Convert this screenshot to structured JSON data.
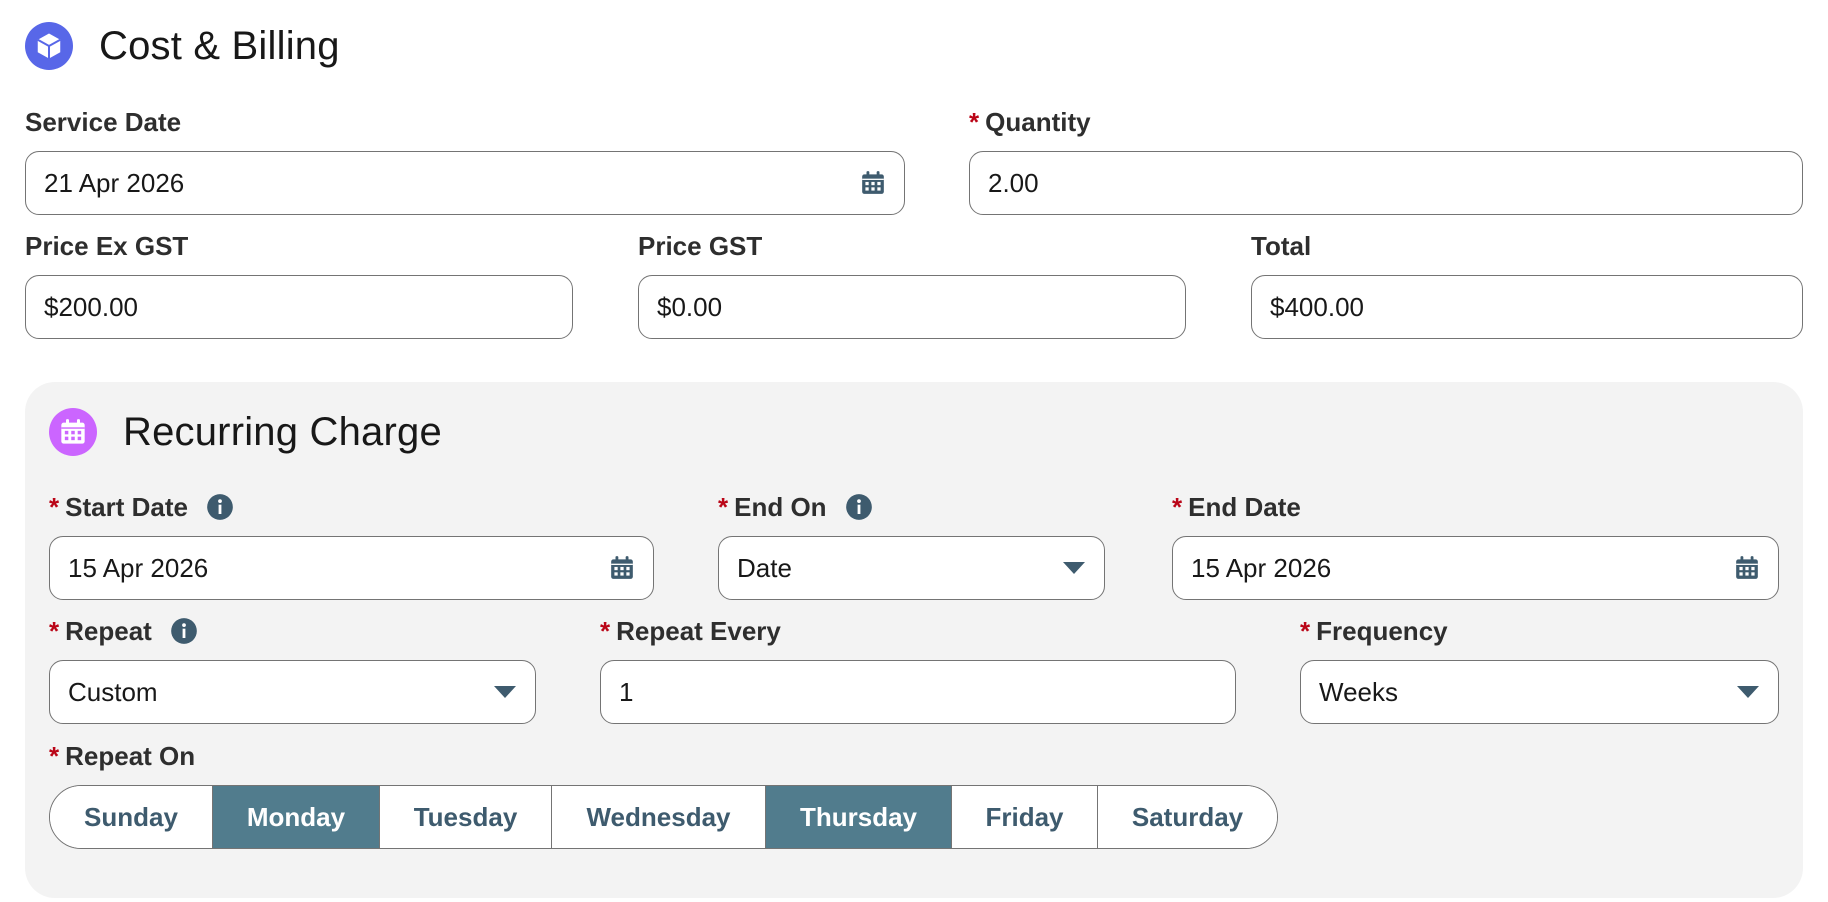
{
  "cost_billing": {
    "title": "Cost & Billing",
    "icon": "box-icon",
    "service_date": {
      "label": "Service Date",
      "value": "21 Apr 2026"
    },
    "quantity": {
      "label": "Quantity",
      "value": "2.00",
      "required": true
    },
    "price_ex_gst": {
      "label": "Price Ex GST",
      "value": "$200.00"
    },
    "price_gst": {
      "label": "Price GST",
      "value": "$0.00"
    },
    "total": {
      "label": "Total",
      "value": "$400.00"
    }
  },
  "recurring": {
    "title": "Recurring Charge",
    "icon": "calendar-icon",
    "start_date": {
      "label": "Start Date",
      "value": "15 Apr 2026",
      "required": true
    },
    "end_on": {
      "label": "End On",
      "value": "Date",
      "required": true
    },
    "end_date": {
      "label": "End Date",
      "value": "15 Apr 2026",
      "required": true
    },
    "repeat": {
      "label": "Repeat",
      "value": "Custom",
      "required": true
    },
    "repeat_every": {
      "label": "Repeat Every",
      "value": "1",
      "required": true
    },
    "frequency": {
      "label": "Frequency",
      "value": "Weeks",
      "required": true
    },
    "repeat_on": {
      "label": "Repeat On",
      "required": true,
      "days": [
        {
          "label": "Sunday",
          "selected": false
        },
        {
          "label": "Monday",
          "selected": true
        },
        {
          "label": "Tuesday",
          "selected": false
        },
        {
          "label": "Wednesday",
          "selected": false
        },
        {
          "label": "Thursday",
          "selected": true
        },
        {
          "label": "Friday",
          "selected": false
        },
        {
          "label": "Saturday",
          "selected": false
        }
      ]
    }
  },
  "colors": {
    "required_asterisk": "#ba0517",
    "cost_icon_bg": "#5867e8",
    "recurring_icon_bg": "#cb65ff",
    "toggle_selected_bg": "#517c8d",
    "toggle_text": "#3e5b6e",
    "panel_bg": "#f3f3f3"
  }
}
